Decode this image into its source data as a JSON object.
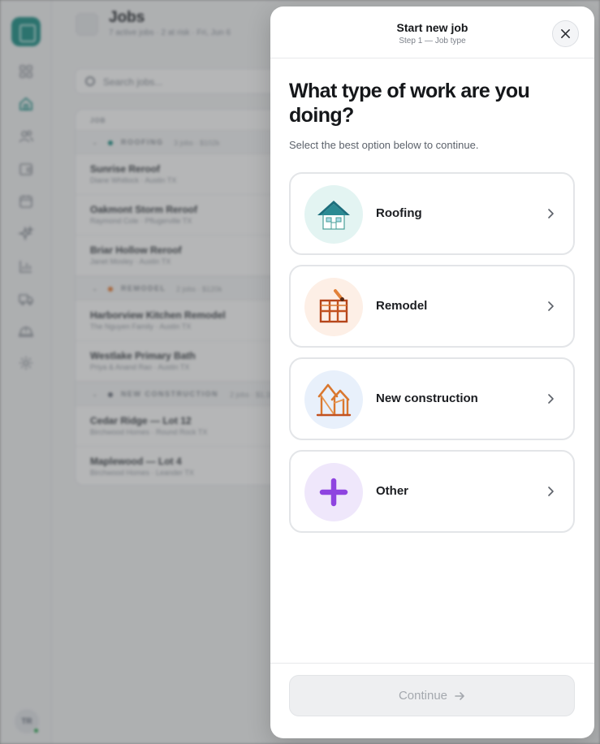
{
  "background": {
    "page_title": "Jobs",
    "page_subtitle": "7 active jobs · 2 at risk · Fri, Jun 6",
    "search_placeholder": "Search jobs...",
    "table_header": "JOB",
    "user_initials": "TR",
    "groups": [
      {
        "name": "ROOFING",
        "meta": "3 jobs · $102k",
        "color": "#1b8f86",
        "jobs": [
          {
            "name": "Sunrise Reroof",
            "sub": "Diane Whitlock · Austin TX"
          },
          {
            "name": "Oakmont Storm Reroof",
            "sub": "Raymond Cole · Pflugerville TX"
          },
          {
            "name": "Briar Hollow Reroof",
            "sub": "Janet Mosley · Austin TX"
          }
        ]
      },
      {
        "name": "REMODEL",
        "meta": "2 jobs · $120k",
        "color": "#e8762c",
        "jobs": [
          {
            "name": "Harborview Kitchen Remodel",
            "sub": "The Nguyen Family · Austin TX"
          },
          {
            "name": "Westlake Primary Bath",
            "sub": "Priya & Anand Rao · Austin TX"
          }
        ]
      },
      {
        "name": "NEW CONSTRUCTION",
        "meta": "2 jobs · $1.1M",
        "color": "#6b7280",
        "jobs": [
          {
            "name": "Cedar Ridge — Lot 12",
            "sub": "Birchwood Homes · Round Rock TX"
          },
          {
            "name": "Maplewood — Lot 4",
            "sub": "Birchwood Homes · Leander TX"
          }
        ]
      }
    ]
  },
  "modal": {
    "title": "Start new job",
    "step": "Step 1 — Job type",
    "question": "What type of work are you doing?",
    "hint": "Select the best option below to continue.",
    "options": [
      {
        "label": "Roofing",
        "icon": "house-roof-icon",
        "bg": "#e3f4f2"
      },
      {
        "label": "Remodel",
        "icon": "remodel-frame-icon",
        "bg": "#fdefe6"
      },
      {
        "label": "New construction",
        "icon": "construction-frame-icon",
        "bg": "#e8f0fb"
      },
      {
        "label": "Other",
        "icon": "plus-icon",
        "bg": "#efe7fb"
      }
    ],
    "continue_label": "Continue",
    "continue_enabled": false
  },
  "colors": {
    "brand": "#1b8f86",
    "orange": "#d9772f",
    "purple": "#8e44e0",
    "disabled_text": "#a4a8ae"
  }
}
